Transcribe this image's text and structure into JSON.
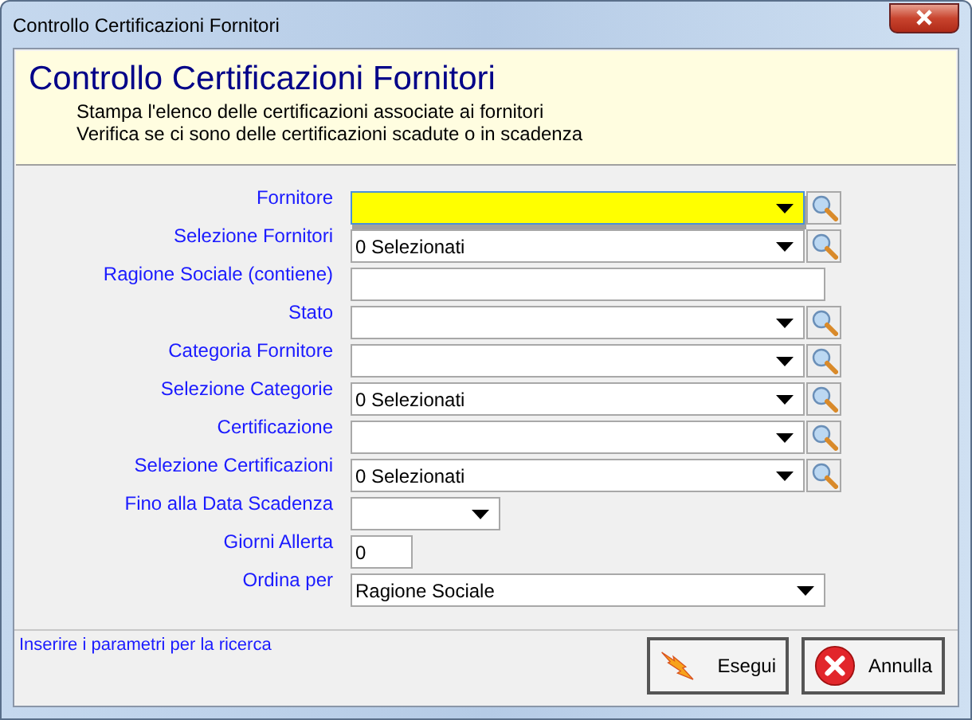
{
  "window": {
    "title": "Controllo Certificazioni Fornitori"
  },
  "header": {
    "title": "Controllo Certificazioni Fornitori",
    "lines": [
      "Stampa l'elenco delle certificazioni associate ai fornitori",
      "Verifica se ci sono delle certificazioni scadute o in scadenza"
    ]
  },
  "fields": [
    {
      "label": "Fornitore",
      "kind": "combo_search",
      "focused": true
    },
    {
      "label": "Selezione Fornitori",
      "kind": "combo_search",
      "value": "0 Selezionati",
      "focused": false
    },
    {
      "label": "Ragione Sociale (contiene)",
      "kind": "text",
      "focused": false
    },
    {
      "label": "Stato",
      "kind": "combo_search",
      "focused": false
    },
    {
      "label": "Categoria Fornitore",
      "kind": "combo_search",
      "focused": false
    },
    {
      "label": "Selezione Categorie",
      "kind": "combo_search",
      "value": "0 Selezionati",
      "focused": false
    },
    {
      "label": "Certificazione",
      "kind": "combo_search",
      "focused": false
    },
    {
      "label": "Selezione Certificazioni",
      "kind": "combo_search",
      "value": "0 Selezionati",
      "focused": false
    },
    {
      "label": "Fino alla Data Scadenza",
      "kind": "date",
      "focused": false
    },
    {
      "label": "Giorni Allerta",
      "kind": "number",
      "value": "0",
      "focused": false
    },
    {
      "label": "Ordina per",
      "kind": "combo",
      "value": "Ragione Sociale",
      "focused": false
    }
  ],
  "status": "Inserire i parametri per la ricerca",
  "buttons": [
    {
      "label": "Esegui",
      "kind": "run"
    },
    {
      "label": "Annulla",
      "kind": "cancel"
    }
  ]
}
